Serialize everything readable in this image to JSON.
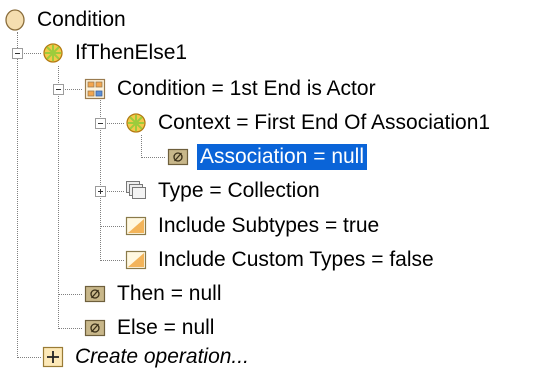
{
  "tree": {
    "root": "Condition",
    "ifthenelse": "IfThenElse1",
    "condition": "Condition = 1st End is Actor",
    "context": "Context = First End Of Association1",
    "association": "Association = null",
    "type": "Type = Collection",
    "include_subtypes": "Include Subtypes = true",
    "include_custom_types": "Include Custom Types = false",
    "then": "Then = null",
    "else": "Else = null",
    "create_operation": "Create operation..."
  },
  "colors": {
    "selection": "#0a64d8",
    "condition_icon": "#f5deb0",
    "ifthenelse_icon": "#9ccc3c",
    "null_icon": "#c8b78a"
  }
}
